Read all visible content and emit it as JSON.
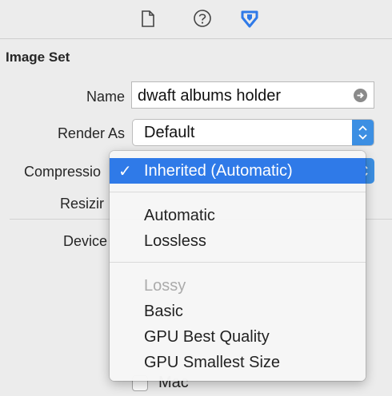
{
  "toolbar": {
    "icons": [
      "file-inspector-icon",
      "quick-help-icon",
      "attributes-inspector-icon"
    ]
  },
  "section": {
    "title": "Image Set"
  },
  "fields": {
    "name_label": "Name",
    "name_value": "dwaft albums holder",
    "render_as_label": "Render As",
    "render_as_value": "Default",
    "compression_label": "Compressio",
    "resizing_label": "Resizir",
    "devices_label": "Device",
    "mac_label": "Mac"
  },
  "menu": {
    "selected": "Inherited (Automatic)",
    "check_mark": "✓",
    "group1": [
      "Automatic",
      "Lossless"
    ],
    "lossy_header": "Lossy",
    "group2": [
      "Basic",
      "GPU Best Quality",
      "GPU Smallest Size"
    ]
  },
  "colors": {
    "accent": "#3c8fe3",
    "selection": "#2f7ae8"
  }
}
